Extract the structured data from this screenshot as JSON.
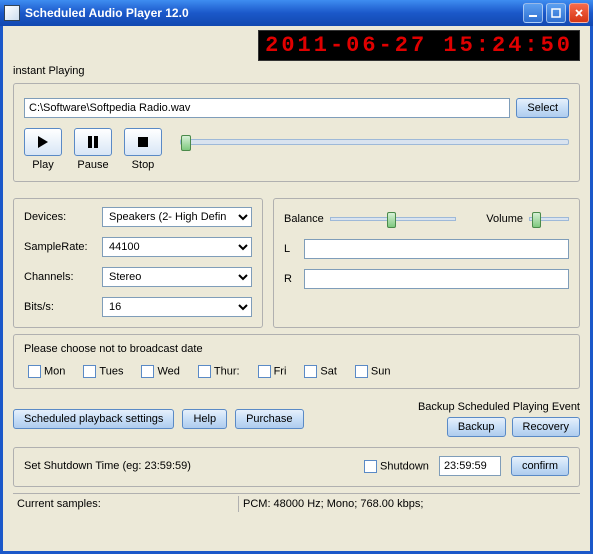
{
  "window": {
    "title": "Scheduled Audio Player  12.0"
  },
  "clock": "2011-06-27 15:24:50",
  "instant": {
    "label": "instant Playing",
    "path": "C:\\Software\\Softpedia Radio.wav",
    "select": "Select",
    "play": "Play",
    "pause": "Pause",
    "stop": "Stop"
  },
  "devices": {
    "devices_label": "Devices:",
    "devices_value": "Speakers (2- High Defin",
    "samplerate_label": "SampleRate:",
    "samplerate_value": "44100",
    "channels_label": "Channels:",
    "channels_value": "Stereo",
    "bits_label": "Bits/s:",
    "bits_value": "16"
  },
  "audio": {
    "balance_label": "Balance",
    "volume_label": "Volume",
    "l_label": "L",
    "r_label": "R",
    "l_value": "",
    "r_value": ""
  },
  "broadcast": {
    "label": "Please choose not to broadcast date",
    "days": [
      "Mon",
      "Tues",
      "Wed",
      "Thur:",
      "Fri",
      "Sat",
      "Sun"
    ]
  },
  "buttons": {
    "scheduled": "Scheduled playback settings",
    "help": "Help",
    "purchase": "Purchase",
    "backup_title": "Backup  Scheduled Playing Event",
    "backup": "Backup",
    "recovery": "Recovery"
  },
  "shutdown": {
    "label": "Set Shutdown Time (eg: 23:59:59)",
    "check_label": "Shutdown",
    "time": "23:59:59",
    "confirm": "confirm"
  },
  "status": {
    "current_label": "Current samples:",
    "current_value": "PCM: 48000 Hz;  Mono; 768.00 kbps;"
  }
}
